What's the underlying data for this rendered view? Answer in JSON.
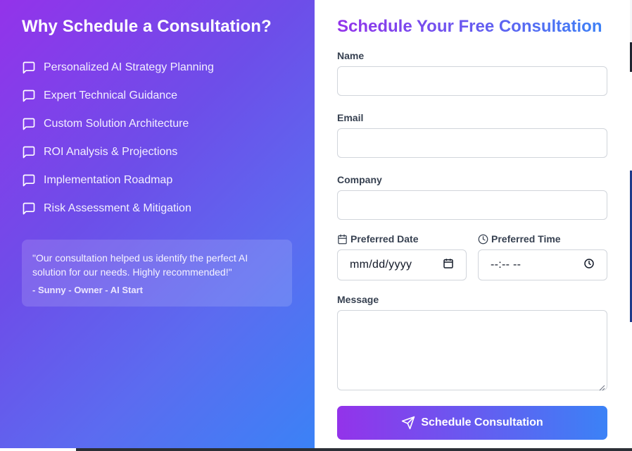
{
  "left": {
    "title": "Why Schedule a Consultation?",
    "benefits": [
      {
        "label": "Personalized AI Strategy Planning",
        "icon": "message-square-icon"
      },
      {
        "label": "Expert Technical Guidance",
        "icon": "message-square-icon"
      },
      {
        "label": "Custom Solution Architecture",
        "icon": "message-square-icon"
      },
      {
        "label": "ROI Analysis & Projections",
        "icon": "message-square-icon"
      },
      {
        "label": "Implementation Roadmap",
        "icon": "message-square-icon"
      },
      {
        "label": "Risk Assessment & Mitigation",
        "icon": "message-square-icon"
      }
    ],
    "testimonial": {
      "quote": "\"Our consultation helped us identify the perfect AI solution for our needs. Highly recommended!\"",
      "author": "- Sunny - Owner - AI Start"
    }
  },
  "form": {
    "title": "Schedule Your Free Consultation",
    "name": {
      "label": "Name",
      "value": ""
    },
    "email": {
      "label": "Email",
      "value": ""
    },
    "company": {
      "label": "Company",
      "value": ""
    },
    "date": {
      "label": "Preferred Date",
      "placeholder": "mm/dd/yyyy",
      "icon": "calendar-icon"
    },
    "time": {
      "label": "Preferred Time",
      "placeholder": "--:-- --",
      "icon": "clock-icon"
    },
    "message": {
      "label": "Message",
      "value": ""
    },
    "submit_label": "Schedule Consultation",
    "submit_icon": "send-icon"
  },
  "colors": {
    "gradient_start": "#9333ea",
    "gradient_end": "#3b82f6",
    "label_text": "#374151",
    "input_border": "#d1d5db"
  }
}
